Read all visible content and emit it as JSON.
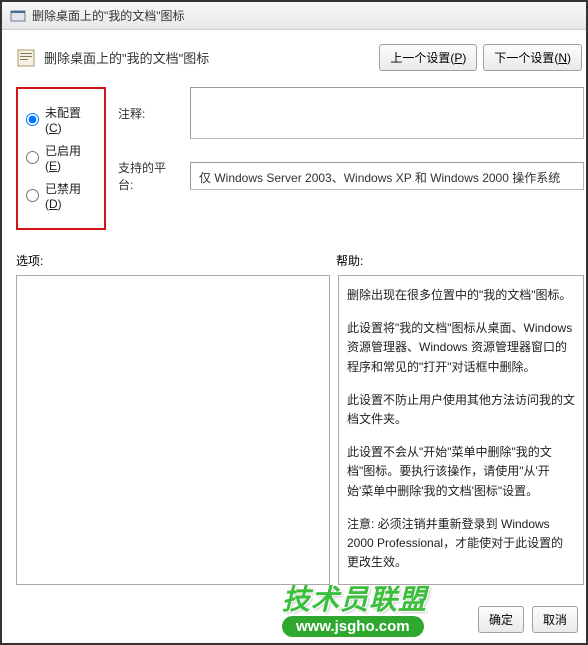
{
  "window": {
    "title": "删除桌面上的\"我的文档\"图标"
  },
  "header": {
    "title": "删除桌面上的\"我的文档\"图标",
    "prev_button": "上一个设置(",
    "prev_key": "P",
    "prev_suffix": ")",
    "next_button": "下一个设置(",
    "next_key": "N",
    "next_suffix": ")"
  },
  "radios": {
    "unconfigured": "未配置(",
    "unconfigured_key": "C",
    "unconfigured_suffix": ")",
    "enabled": "已启用(",
    "enabled_key": "E",
    "enabled_suffix": ")",
    "disabled": "已禁用(",
    "disabled_key": "D",
    "disabled_suffix": ")"
  },
  "labels": {
    "comment": "注释:",
    "platform": "支持的平台:",
    "options": "选项:",
    "help": "帮助:"
  },
  "platform_text": "仅 Windows Server 2003、Windows XP 和 Windows 2000 操作系统",
  "help": {
    "p1": "删除出现在很多位置中的\"我的文档\"图标。",
    "p2": "此设置将\"我的文档\"图标从桌面、Windows 资源管理器、Windows 资源管理器窗口的程序和常见的\"打开\"对话框中删除。",
    "p3": "此设置不防止用户使用其他方法访问我的文档文件夹。",
    "p4": "此设置不会从\"开始\"菜单中删除\"我的文档\"图标。要执行该操作，请使用\"从'开始'菜单中删除'我的文档'图标\"设置。",
    "p5": "注意: 必须注销并重新登录到 Windows 2000 Professional，才能使对于此设置的更改生效。"
  },
  "footer": {
    "ok": "确定",
    "cancel": "取消"
  },
  "watermark": {
    "line1": "技术员联盟",
    "line2": "www.jsgho.com"
  }
}
